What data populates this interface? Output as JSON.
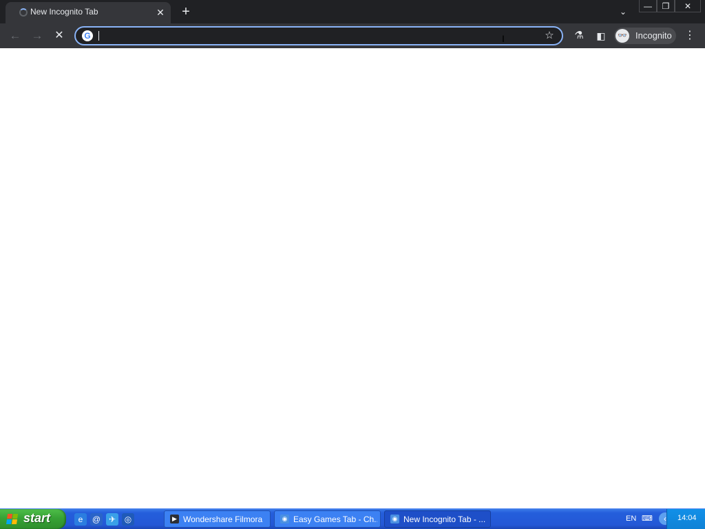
{
  "colors": {
    "tabstrip_bg": "#202124",
    "toolbar_bg": "#35363a",
    "omnibox_border": "#8ab4f8",
    "taskbar_blue": "#245edb",
    "start_green": "#37a235"
  },
  "tab": {
    "title": "New Incognito Tab",
    "close_glyph": "✕",
    "loading_icon": "spinner-icon"
  },
  "tabstrip": {
    "new_tab_glyph": "+",
    "tab_search_glyph": "⌄"
  },
  "window_controls": {
    "minimize": "—",
    "maximize": "❐",
    "close": "✕"
  },
  "toolbar": {
    "back_glyph": "←",
    "forward_glyph": "→",
    "stop_glyph": "✕",
    "omnibox_value": "",
    "search_engine_icon": "G",
    "bookmark_glyph": "☆",
    "labs_glyph": "⚗",
    "side_panel_glyph": "◧",
    "profile_label": "Incognito",
    "profile_glyph": "👓",
    "menu_glyph": "⋮"
  },
  "taskbar": {
    "start_label": "start",
    "quick_launch": [
      {
        "name": "internet-explorer-icon",
        "glyph": "e",
        "color": "#2b7de0"
      },
      {
        "name": "outlook-express-icon",
        "glyph": "@",
        "color": "#2a64c8"
      },
      {
        "name": "messenger-icon",
        "glyph": "✈",
        "color": "#3aa0e8"
      },
      {
        "name": "browser-icon",
        "glyph": "◎",
        "color": "#1f5ab8"
      }
    ],
    "tasks": [
      {
        "label": "Wondershare Filmora",
        "icon": "filmora-icon",
        "glyph": "▶",
        "icon_color": "#2c2f36",
        "active": false
      },
      {
        "label": "Easy Games Tab - Ch...",
        "icon": "chrome-icon",
        "glyph": "◉",
        "icon_color": "#4a90e2",
        "active": false
      },
      {
        "label": "New Incognito Tab - ...",
        "icon": "chrome-icon",
        "glyph": "◉",
        "icon_color": "#4a90e2",
        "active": true
      }
    ],
    "tray": {
      "language": "EN",
      "keyboard_glyph": "⌨",
      "arrow_glyph": "‹",
      "time": "14:04"
    }
  }
}
